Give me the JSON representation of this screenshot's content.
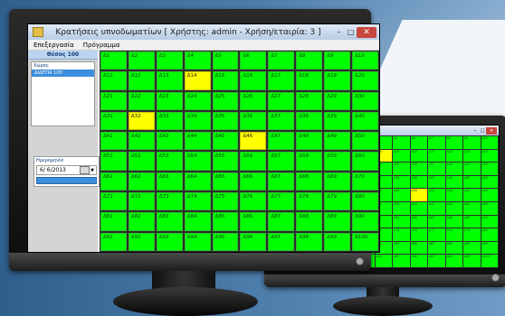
{
  "window": {
    "title": "Κρατήσεις υπνοδωματίων   [ Χρήστης: admin - Χρήση/εταιρία: 3 ]",
    "minimize": "–",
    "maximize": "□",
    "close": "✕"
  },
  "menu": [
    "Επεξεργασία",
    "Πρόγραμμα"
  ],
  "sidebar": {
    "floor": "Θέσος 100",
    "space_title": "Χώρος",
    "spaces": [
      "ΔΙΔΕΤΙΑ 1ΟΥ"
    ],
    "date_title": "Ημερομηνία",
    "date_value": "6/ 6/2013"
  },
  "rooms": [
    [
      "Δ1",
      "Δ2",
      "Δ3",
      "Δ4",
      "Δ5",
      "Δ6",
      "Δ7",
      "Δ8",
      "Δ9",
      "Δ10"
    ],
    [
      "Δ11",
      "Δ12",
      "Δ13",
      "Δ14",
      "Δ15",
      "Δ16",
      "Δ17",
      "Δ18",
      "Δ19",
      "Δ20"
    ],
    [
      "Δ21",
      "Δ22",
      "Δ23",
      "Δ24",
      "Δ25",
      "Δ26",
      "Δ27",
      "Δ28",
      "Δ29",
      "Δ30"
    ],
    [
      "Δ31",
      "Δ32",
      "Δ33",
      "Δ34",
      "Δ35",
      "Δ36",
      "Δ37",
      "Δ38",
      "Δ39",
      "Δ40"
    ],
    [
      "Δ41",
      "Δ42",
      "Δ43",
      "Δ44",
      "Δ45",
      "Δ46",
      "Δ47",
      "Δ48",
      "Δ49",
      "Δ50"
    ],
    [
      "Δ51",
      "Δ52",
      "Δ53",
      "Δ54",
      "Δ55",
      "Δ56",
      "Δ57",
      "Δ58",
      "Δ59",
      "Δ60"
    ],
    [
      "Δ61",
      "Δ62",
      "Δ63",
      "Δ64",
      "Δ65",
      "Δ66",
      "Δ67",
      "Δ68",
      "Δ69",
      "Δ70"
    ],
    [
      "Δ71",
      "Δ72",
      "Δ73",
      "Δ74",
      "Δ75",
      "Δ76",
      "Δ77",
      "Δ78",
      "Δ79",
      "Δ80"
    ],
    [
      "Δ81",
      "Δ82",
      "Δ83",
      "Δ84",
      "Δ85",
      "Δ86",
      "Δ87",
      "Δ88",
      "Δ89",
      "Δ90"
    ],
    [
      "Δ91",
      "Δ92",
      "Δ93",
      "Δ94",
      "Δ95",
      "Δ96",
      "Δ97",
      "Δ98",
      "Δ99",
      "Δ100"
    ]
  ],
  "occupied": [
    "Δ14",
    "Δ32",
    "Δ46"
  ],
  "status_colors": {
    "free": "#00ff00",
    "occupied": "#ffff00"
  },
  "second_window": {
    "title": "ιάτα - Χρήση/εταιρία: 3 ]",
    "minimize": "–",
    "maximize": "□",
    "close": "✕"
  }
}
